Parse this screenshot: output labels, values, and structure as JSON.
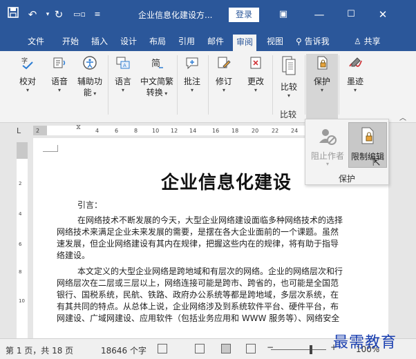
{
  "window": {
    "title": "企业信息化建设方...",
    "login_label": "登录",
    "icons": [
      "save-icon",
      "undo-icon",
      "redo-icon",
      "touch-mode-icon",
      "customize-icon"
    ]
  },
  "tabs": [
    "文件",
    "开始",
    "插入",
    "设计",
    "布局",
    "引用",
    "邮件",
    "审阅",
    "视图"
  ],
  "tab_active": "审阅",
  "tell_me": "告诉我",
  "share": "共享",
  "ribbon": {
    "proofing": "校对",
    "language": "语音",
    "accessibility_line1": "辅助功",
    "accessibility_line2": "能",
    "lang": "语言",
    "convert_line1": "中文简繁",
    "convert_line2": "转换",
    "comment": "批注",
    "track": "修订",
    "changes": "更改",
    "compare": "比较",
    "compare_group": "比较",
    "protect": "保护",
    "ink": "墨迹"
  },
  "ruler": {
    "corner": "L",
    "marks": [
      "2",
      "2",
      "4",
      "6",
      "8",
      "10",
      "12",
      "14",
      "16",
      "18",
      "20",
      "22",
      "24"
    ],
    "vmarks": [
      "2",
      "4",
      "6",
      "8",
      "10"
    ]
  },
  "dropdown": {
    "block_authors": "阻止作者",
    "restrict_editing": "限制编辑",
    "group": "保护"
  },
  "document": {
    "title": "企业信息化建设",
    "intro": "引言：",
    "para1": [
      "在网络技术不断发展的今天，大型企业网络建设面临多种网络技术的选择",
      "网络技术来满足企业未来发展的需要，是摆在各大企业面前的一个课题。虽然",
      "速发展，但企业网络建设有其内在规律，把握这些内在的规律，将有助于指导",
      "络建设。"
    ],
    "para2": [
      "本文定义的大型企业网络是跨地域和有层次的网络。企业的网络层次和行",
      "网络层次在二层或三层以上，网络连接可能是跨市、跨省的，也可能是全国范",
      "银行、国税系统，民航、铁路、政府办公系统等都是跨地域，多层次系统，在",
      "有其共同的特点。从总体上说，企业网络涉及到系统软件平台、硬件平台，布",
      "网建设、广域网建设、应用软件（包括业务应用和 WWW 服务等）、网络安全"
    ]
  },
  "status": {
    "page": "第 1 页，共 18 页",
    "words": "18646 个字",
    "zoom": "100%"
  },
  "watermark": "最需教育"
}
